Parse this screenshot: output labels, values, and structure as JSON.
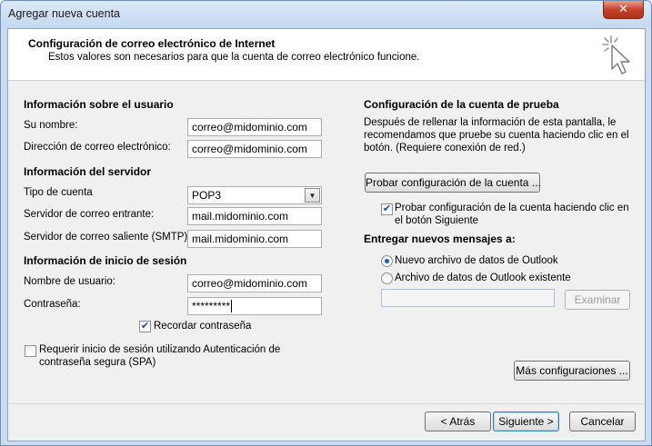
{
  "window": {
    "title": "Agregar nueva cuenta",
    "close_glyph": "✕"
  },
  "header": {
    "title": "Configuración de correo electrónico de Internet",
    "subtitle": "Estos valores son necesarios para que la cuenta de correo electrónico funcione."
  },
  "user_info": {
    "heading": "Información sobre el usuario",
    "name_label": "Su nombre:",
    "name_value": "correo@midominio.com",
    "email_label": "Dirección de correo electrónico:",
    "email_value": "correo@midominio.com"
  },
  "server_info": {
    "heading": "Información del servidor",
    "account_type_label": "Tipo de cuenta",
    "account_type_value": "POP3",
    "incoming_label": "Servidor de correo entrante:",
    "incoming_value": "mail.midominio.com",
    "outgoing_label": "Servidor de correo saliente (SMTP):",
    "outgoing_value": "mail.midominio.com"
  },
  "login_info": {
    "heading": "Información de inicio de sesión",
    "username_label": "Nombre de usuario:",
    "username_value": "correo@midominio.com",
    "password_label": "Contraseña:",
    "password_value": "*********",
    "remember_label": "Recordar contraseña",
    "remember_checked": true,
    "spa_label_line1": "Requerir inicio de sesión utilizando Autenticación de",
    "spa_label_line2": "contraseña segura (SPA)",
    "spa_checked": false
  },
  "test_settings": {
    "heading": "Configuración de la cuenta de prueba",
    "desc_line1": "Después de rellenar la información de esta pantalla, le",
    "desc_line2": "recomendamos que pruebe su cuenta haciendo clic en el",
    "desc_line3": "botón. (Requiere conexión de red.)",
    "test_button": "Probar configuración de la cuenta ...",
    "auto_test_line1": "Probar configuración de la cuenta haciendo clic en",
    "auto_test_line2": "el botón Siguiente",
    "auto_test_checked": true
  },
  "deliver": {
    "heading": "Entregar nuevos mensajes a:",
    "new_file_label": "Nuevo archivo de datos de Outlook",
    "existing_file_label": "Archivo de datos de Outlook existente",
    "selected": "new",
    "path_value": "",
    "browse_button": "Examinar"
  },
  "more_settings_button": "Más configuraciones ...",
  "footer": {
    "back_button": "< Atrás",
    "next_button": "Siguiente >",
    "cancel_button": "Cancelar"
  },
  "icons": {
    "header_icon": "mouse-cursor-sparkle-icon",
    "dropdown": "chevron-down-icon",
    "check": "checkmark-icon"
  }
}
